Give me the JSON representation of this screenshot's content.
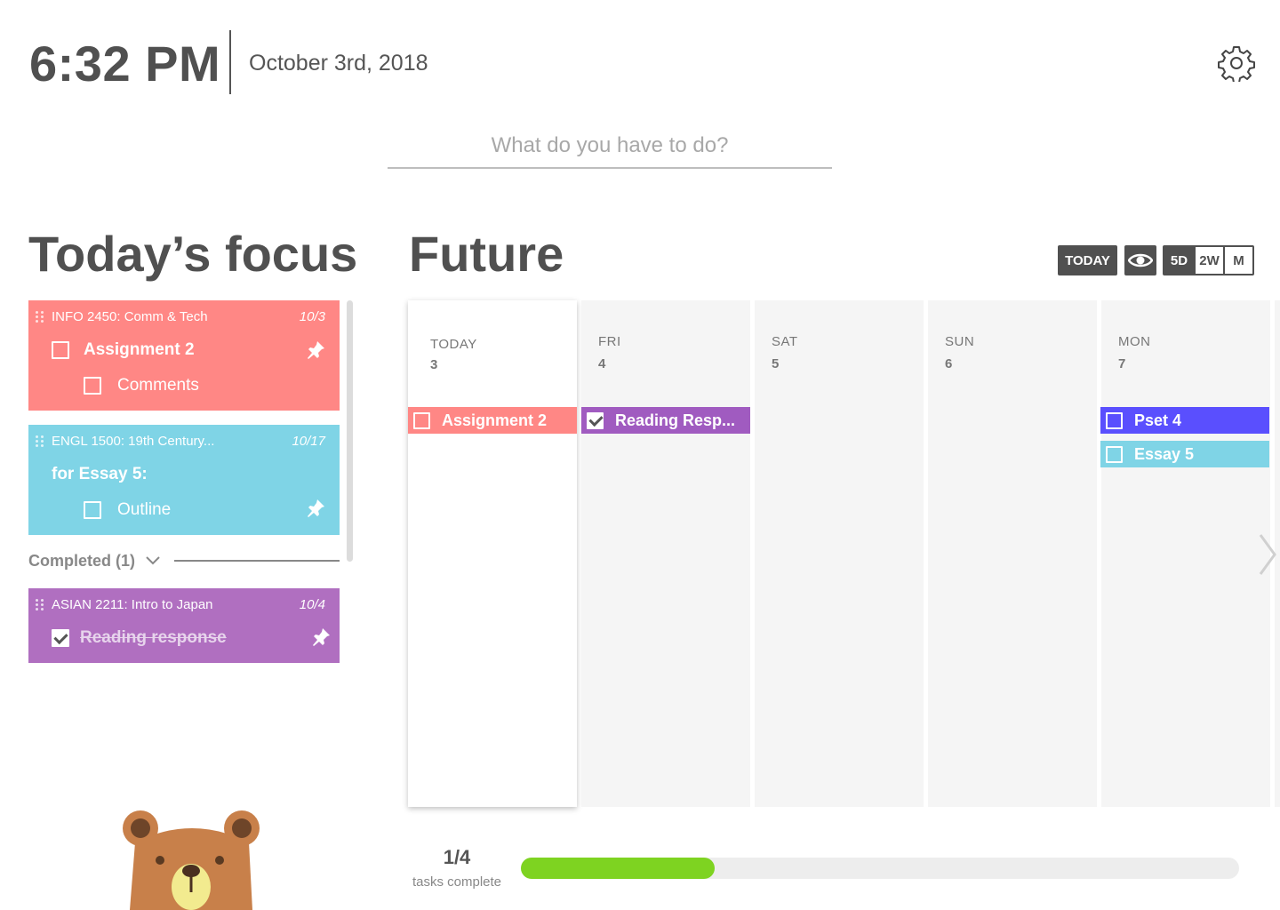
{
  "header": {
    "time": "6:32 PM",
    "date": "October 3rd, 2018",
    "settings_icon": "gear-icon"
  },
  "search": {
    "placeholder": "What do you have to do?",
    "value": ""
  },
  "focus": {
    "title": "Today’s focus",
    "cards": [
      {
        "course": "INFO 2450: Comm & Tech",
        "due": "10/3",
        "color": "#ff8785",
        "task": "Assignment 2",
        "subtask": "Comments"
      },
      {
        "course": "ENGL 1500: 19th Century...",
        "due": "10/17",
        "color": "#7fd4e6",
        "task": "for Essay 5:",
        "subtask": "Outline"
      }
    ],
    "completed": {
      "label": "Completed (1)",
      "cards": [
        {
          "course": "ASIAN 2211: Intro to Japan",
          "due": "10/4",
          "color": "#b06fc0",
          "task": "Reading response",
          "checked": true
        }
      ]
    }
  },
  "future": {
    "title": "Future",
    "controls": {
      "today": "TODAY",
      "eye_icon": "eye-icon",
      "views": [
        "5D",
        "2W",
        "M"
      ],
      "active_view": "5D"
    },
    "days": [
      {
        "name": "TODAY",
        "num": "3",
        "events": [
          {
            "label": "Assignment 2",
            "color": "#ff8785",
            "checked": false
          }
        ]
      },
      {
        "name": "FRI",
        "num": "4",
        "events": [
          {
            "label": "Reading Resp...",
            "color": "#a05bc0",
            "checked": true
          }
        ]
      },
      {
        "name": "SAT",
        "num": "5",
        "events": []
      },
      {
        "name": "SUN",
        "num": "6",
        "events": []
      },
      {
        "name": "MON",
        "num": "7",
        "events": [
          {
            "label": "Pset 4",
            "color": "#5a4ffe",
            "checked": false
          },
          {
            "label": "Essay 5",
            "color": "#7fd4e6",
            "checked": false
          }
        ]
      }
    ],
    "next_icon": "chevron-right-icon"
  },
  "progress": {
    "count": "1/4",
    "label": "tasks complete",
    "fraction": 0.27,
    "color": "#7ed321"
  },
  "mascot": "bear-mascot"
}
